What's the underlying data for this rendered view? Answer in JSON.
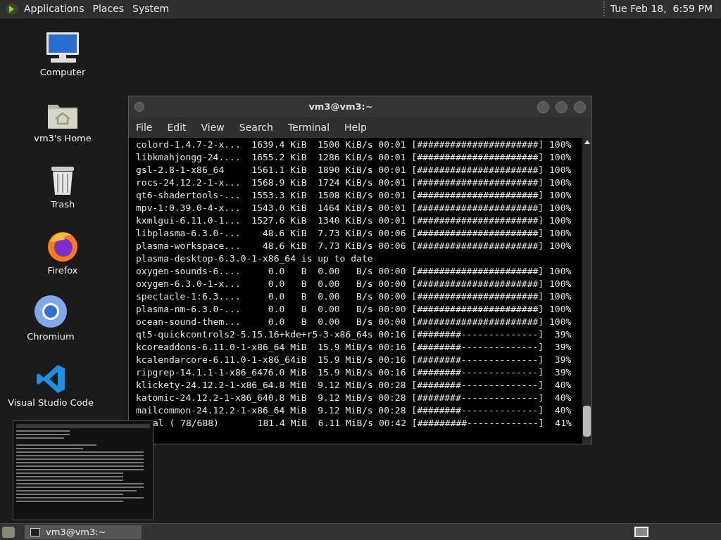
{
  "top_panel": {
    "menus": [
      "Applications",
      "Places",
      "System"
    ],
    "clock": "Tue Feb 18,  6:59 PM"
  },
  "desktop_icons": [
    {
      "kind": "computer",
      "label": "Computer"
    },
    {
      "kind": "home",
      "label": "vm3's Home"
    },
    {
      "kind": "trash",
      "label": "Trash"
    },
    {
      "kind": "firefox",
      "label": "Firefox"
    },
    {
      "kind": "chromium",
      "label": "Chromium"
    },
    {
      "kind": "vscode",
      "label": "Visual Studio Code"
    }
  ],
  "terminal": {
    "title": "vm3@vm3:~",
    "menu": [
      "File",
      "Edit",
      "View",
      "Search",
      "Terminal",
      "Help"
    ],
    "lines": [
      "colord-1.4.7-2-x...  1639.4 KiB  1500 KiB/s 00:01 [######################] 100%",
      "libkmahjongg-24....  1655.2 KiB  1286 KiB/s 00:01 [######################] 100%",
      "gsl-2.8-1-x86_64     1561.1 KiB  1890 KiB/s 00:01 [######################] 100%",
      "rocs-24.12.2-1-x...  1568.9 KiB  1724 KiB/s 00:01 [######################] 100%",
      "qt6-shadertools-...  1553.3 KiB  1508 KiB/s 00:01 [######################] 100%",
      "mpv-1:0.39.0-4-x...  1543.0 KiB  1464 KiB/s 00:01 [######################] 100%",
      "kxmlgui-6.11.0-1...  1527.6 KiB  1340 KiB/s 00:01 [######################] 100%",
      "libplasma-6.3.0-...    48.6 KiB  7.73 KiB/s 00:06 [######################] 100%",
      "plasma-workspace...    48.6 KiB  7.73 KiB/s 00:06 [######################] 100%",
      "plasma-desktop-6.3.0-1-x86_64 is up to date",
      "oxygen-sounds-6....     0.0   B  0.00   B/s 00:00 [######################] 100%",
      "oxygen-6.3.0-1-x...     0.0   B  0.00   B/s 00:00 [######################] 100%",
      "spectacle-1:6.3....     0.0   B  0.00   B/s 00:00 [######################] 100%",
      "plasma-nm-6.3.0-...     0.0   B  0.00   B/s 00:00 [######################] 100%",
      "ocean-sound-them...     0.0   B  0.00   B/s 00:00 [######################] 100%",
      "qt5-quickcontrols2-5.15.16+kde+r5-3-x86_64s 00:16 [########--------------]  39%",
      "kcoreaddons-6.11.0-1-x86_64 MiB  15.9 MiB/s 00:16 [########--------------]  39%",
      "kcalendarcore-6.11.0-1-x86_64iB  15.9 MiB/s 00:16 [########--------------]  39%",
      "ripgrep-14.1.1-1-x86_6476.0 MiB  15.9 MiB/s 00:16 [########--------------]  39%",
      "klickety-24.12.2-1-x86_64.8 MiB  9.12 MiB/s 00:28 [########--------------]  40%",
      "katomic-24.12.2-1-x86_640.8 MiB  9.12 MiB/s 00:28 [########--------------]  40%",
      "mailcommon-24.12.2-1-x86_64 MiB  9.12 MiB/s 00:28 [########--------------]  40%"
    ],
    "partly_covered_line": "al ( 78/688)       181.4 MiB  6.11 MiB/s 00:42 [#########-------------]  41%"
  },
  "taskbar": {
    "tasks": [
      {
        "label": "vm3@vm3:~",
        "selected": true
      }
    ]
  }
}
